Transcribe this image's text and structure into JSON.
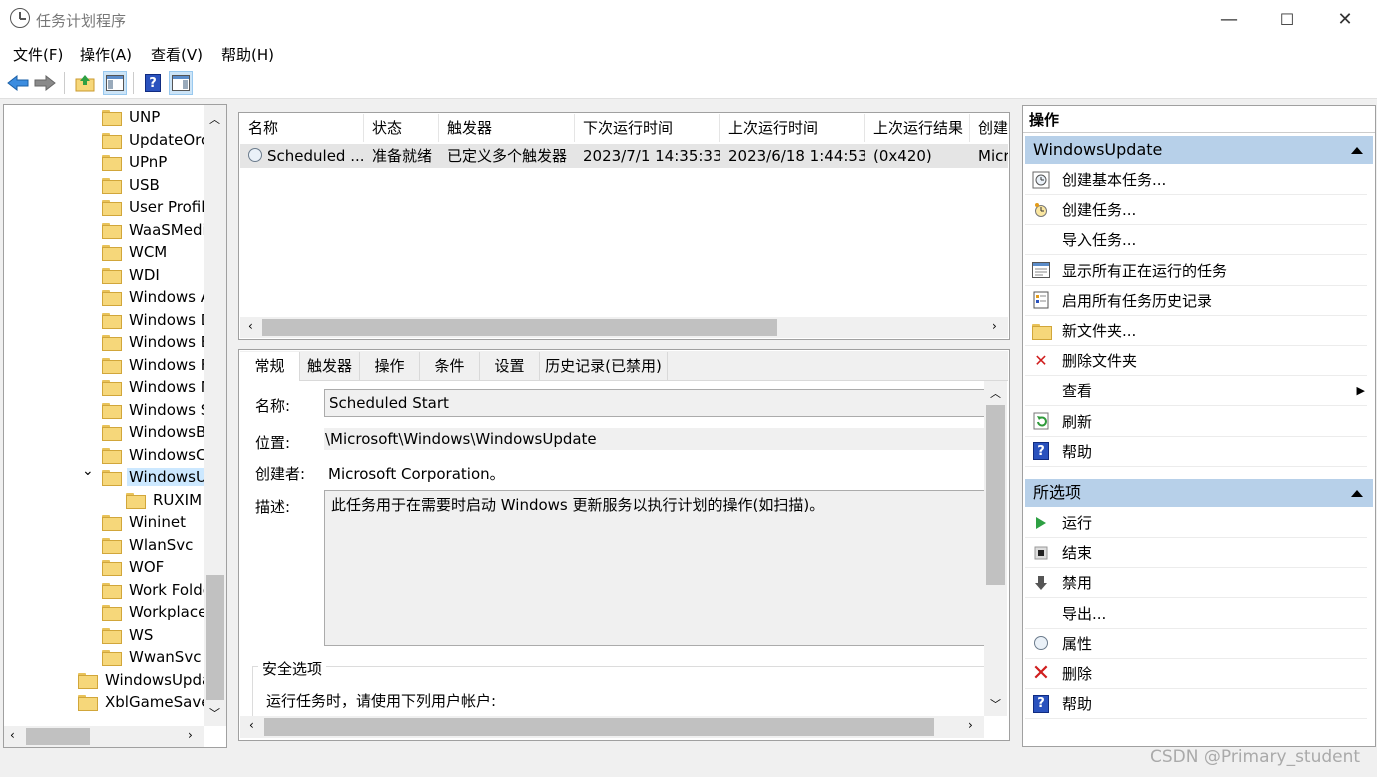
{
  "window": {
    "title": "任务计划程序",
    "minimize": "—",
    "maximize": "☐",
    "close": "✕"
  },
  "menu": [
    "文件(F)",
    "操作(A)",
    "查看(V)",
    "帮助(H)"
  ],
  "toolbar": {
    "back": "back-arrow",
    "forward": "forward-arrow",
    "up": "up-folder",
    "show_hide": "show-hide-tree",
    "help": "?",
    "show_action": "show-action-pane"
  },
  "tree": {
    "items": [
      {
        "label": "UNP",
        "level": 2
      },
      {
        "label": "UpdateOrc",
        "level": 2
      },
      {
        "label": "UPnP",
        "level": 2
      },
      {
        "label": "USB",
        "level": 2
      },
      {
        "label": "User Profile",
        "level": 2
      },
      {
        "label": "WaaSMedi",
        "level": 2
      },
      {
        "label": "WCM",
        "level": 2
      },
      {
        "label": "WDI",
        "level": 2
      },
      {
        "label": "Windows A",
        "level": 2
      },
      {
        "label": "Windows D",
        "level": 2
      },
      {
        "label": "Windows E",
        "level": 2
      },
      {
        "label": "Windows F",
        "level": 2
      },
      {
        "label": "Windows M",
        "level": 2
      },
      {
        "label": "Windows S",
        "level": 2
      },
      {
        "label": "WindowsBa",
        "level": 2
      },
      {
        "label": "WindowsCo",
        "level": 2
      },
      {
        "label": "WindowsU",
        "level": 2,
        "selected": true,
        "expanded": true
      },
      {
        "label": "RUXIM",
        "level": 3
      },
      {
        "label": "Wininet",
        "level": 2
      },
      {
        "label": "WlanSvc",
        "level": 2
      },
      {
        "label": "WOF",
        "level": 2
      },
      {
        "label": "Work Folde",
        "level": 2
      },
      {
        "label": "Workplace",
        "level": 2
      },
      {
        "label": "WS",
        "level": 2
      },
      {
        "label": "WwanSvc",
        "level": 2
      },
      {
        "label": "WindowsUpda",
        "level": 1
      },
      {
        "label": "XblGameSave",
        "level": 1
      }
    ]
  },
  "task_list": {
    "columns": [
      "名称",
      "状态",
      "触发器",
      "下次运行时间",
      "上次运行时间",
      "上次运行结果",
      "创建"
    ],
    "rows": [
      [
        "Scheduled ...",
        "准备就绪",
        "已定义多个触发器",
        "2023/7/1 14:35:33",
        "2023/6/18 1:44:53",
        "(0x420)",
        "Micr"
      ]
    ]
  },
  "details": {
    "tabs": [
      "常规",
      "触发器",
      "操作",
      "条件",
      "设置",
      "历史记录(已禁用)"
    ],
    "name_label": "名称:",
    "name_value": "Scheduled Start",
    "location_label": "位置:",
    "location_value": "\\Microsoft\\Windows\\WindowsUpdate",
    "author_label": "创建者:",
    "author_value": "Microsoft Corporation。",
    "description_label": "描述:",
    "description_value": "此任务用于在需要时启动 Windows 更新服务以执行计划的操作(如扫描)。",
    "security_title": "安全选项",
    "security_text": "运行任务时，请使用下列用户帐户:"
  },
  "actions": {
    "title": "操作",
    "section1": {
      "header": "WindowsUpdate",
      "items": [
        {
          "label": "创建基本任务...",
          "icon": "create-basic-task-icon"
        },
        {
          "label": "创建任务...",
          "icon": "create-task-icon"
        },
        {
          "label": "导入任务...",
          "icon": ""
        },
        {
          "label": "显示所有正在运行的任务",
          "icon": "running-tasks-icon"
        },
        {
          "label": "启用所有任务历史记录",
          "icon": "history-icon"
        },
        {
          "label": "新文件夹...",
          "icon": "new-folder-icon"
        },
        {
          "label": "删除文件夹",
          "icon": "delete-folder-icon"
        },
        {
          "label": "查看",
          "icon": ""
        },
        {
          "label": "刷新",
          "icon": "refresh-icon"
        },
        {
          "label": "帮助",
          "icon": "help-icon"
        }
      ]
    },
    "section2": {
      "header": "所选项",
      "items": [
        {
          "label": "运行",
          "icon": "run-icon"
        },
        {
          "label": "结束",
          "icon": "end-icon"
        },
        {
          "label": "禁用",
          "icon": "disable-icon"
        },
        {
          "label": "导出...",
          "icon": ""
        },
        {
          "label": "属性",
          "icon": "properties-icon"
        },
        {
          "label": "删除",
          "icon": "delete-icon"
        },
        {
          "label": "帮助",
          "icon": "help-icon"
        }
      ]
    }
  },
  "watermark": "CSDN @Primary_student",
  "colors": {
    "section_header": "#b7d0e9",
    "selected_tree": "#cce8ff",
    "accent": "#2a52be"
  }
}
